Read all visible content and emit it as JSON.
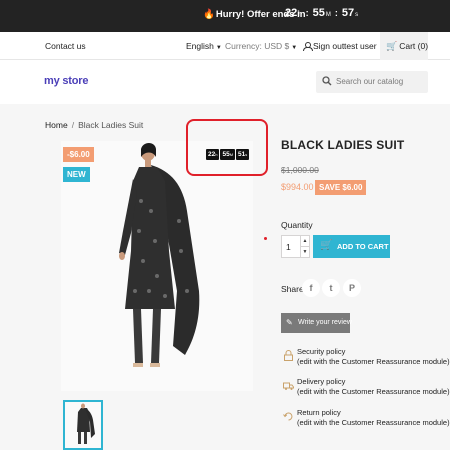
{
  "banner": {
    "message": "Hurry! Offer ends in",
    "hours": "22",
    "hours_unit": "h",
    "minutes": "55",
    "minutes_unit": "M",
    "seconds": "57",
    "seconds_unit": "s",
    "separator": ":"
  },
  "nav": {
    "contact": "Contact us",
    "language": "English",
    "currency": "Currency: USD $",
    "signout": "Sign out",
    "username": "test user",
    "cart": "Cart (0)"
  },
  "header": {
    "logo_my": "my",
    "logo_store": "store",
    "search_placeholder": "Search our catalog"
  },
  "breadcrumb": {
    "home": "Home",
    "separator": "/",
    "current": "Black Ladies Suit"
  },
  "product": {
    "title": "BLACK LADIES SUIT",
    "old_price": "$1,000.00",
    "price": "$994.00",
    "save_label": "SAVE $6.00",
    "discount_badge": "-$6.00",
    "new_badge": "NEW"
  },
  "mini_timer": {
    "hours": "22",
    "hours_unit": "h",
    "minutes": "55",
    "minutes_unit": "M",
    "seconds": "51",
    "seconds_unit": "s"
  },
  "quantity": {
    "label": "Quantity",
    "value": "1"
  },
  "add_to_cart": "ADD TO CART",
  "share": {
    "label": "Share",
    "facebook": "f",
    "twitter": "t",
    "pinterest": "P"
  },
  "review_button": "Write your review",
  "reassurance": [
    {
      "title": "Security policy",
      "desc": "(edit with the Customer Reassurance module)"
    },
    {
      "title": "Delivery policy",
      "desc": "(edit with the Customer Reassurance module)"
    },
    {
      "title": "Return policy",
      "desc": "(edit with the Customer Reassurance module)"
    }
  ],
  "colors": {
    "accent": "#2fb5d2",
    "discount": "#f39d72",
    "highlight": "#e0202a",
    "banner_bg": "#232323"
  }
}
